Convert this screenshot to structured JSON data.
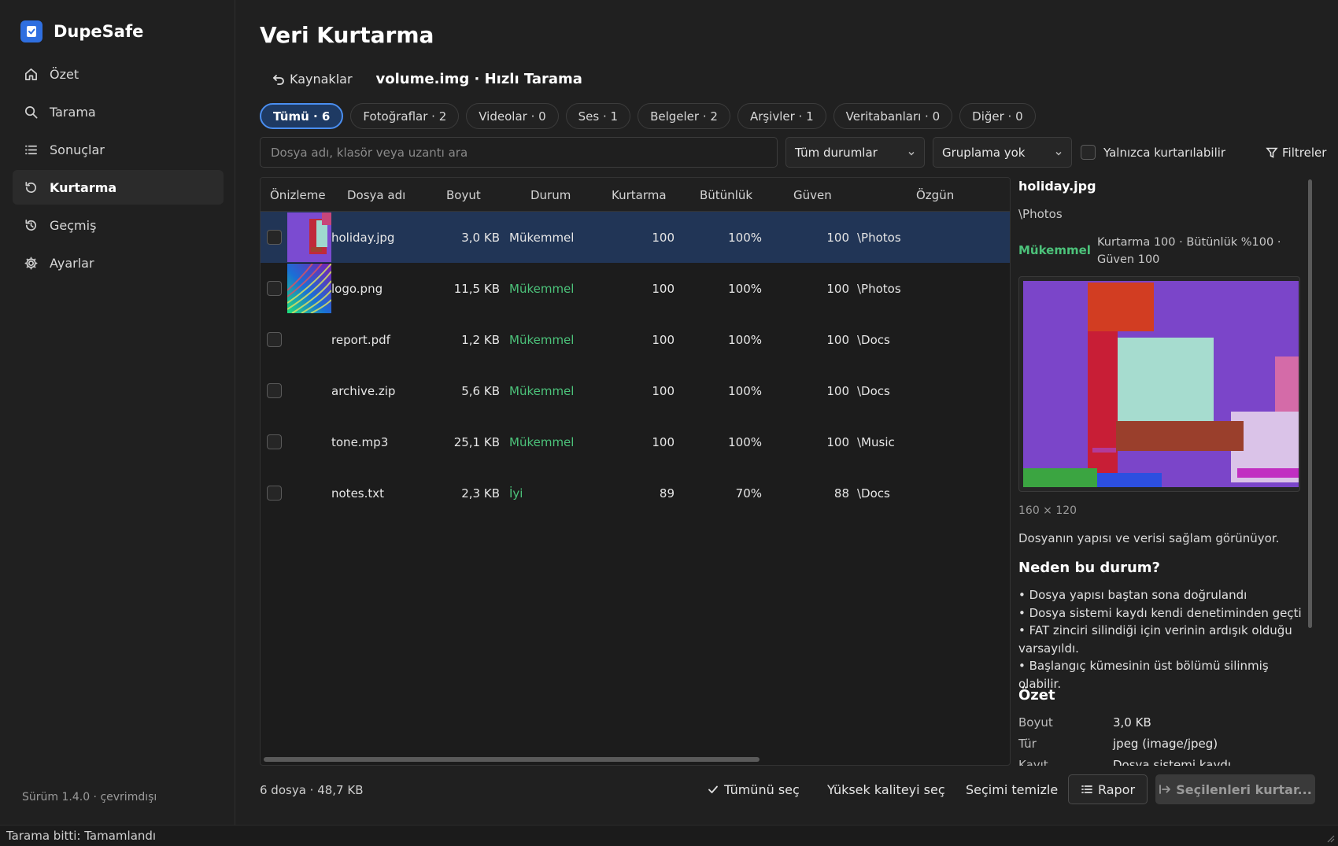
{
  "app": {
    "name": "DupeSafe",
    "version": "Sürüm 1.4.0 · çevrimdışı",
    "status": "Tarama bitti: Tamamlandı"
  },
  "sidebar": {
    "items": [
      {
        "label": "Özet",
        "icon": "home-icon"
      },
      {
        "label": "Tarama",
        "icon": "search-icon"
      },
      {
        "label": "Sonuçlar",
        "icon": "list-icon"
      },
      {
        "label": "Kurtarma",
        "icon": "restore-icon",
        "active": true
      },
      {
        "label": "Geçmiş",
        "icon": "history-icon"
      },
      {
        "label": "Ayarlar",
        "icon": "gear-icon"
      }
    ]
  },
  "main": {
    "title": "Veri Kurtarma",
    "back_label": "Kaynaklar",
    "scan_title": "volume.img · Hızlı Tarama",
    "chips": [
      "Tümü · 6",
      "Fotoğraflar · 2",
      "Videolar · 0",
      "Ses · 1",
      "Belgeler · 2",
      "Arşivler · 1",
      "Veritabanları · 0",
      "Diğer · 0"
    ],
    "search_placeholder": "Dosya adı, klasör veya uzantı ara",
    "status_filter": "Tüm durumlar",
    "grouping": "Gruplama yok",
    "only_recoverable": "Yalnızca kurtarılabilir",
    "filters_label": "Filtreler"
  },
  "table": {
    "headers": [
      "Önizleme",
      "Dosya adı",
      "Boyut",
      "Durum",
      "Kurtarma",
      "Bütünlük",
      "Güven",
      "Özgün"
    ],
    "rows": [
      {
        "name": "holiday.jpg",
        "size": "3,0 KB",
        "status": "Mükemmel",
        "recovery": "100",
        "integrity": "100%",
        "confidence": "100",
        "path": "\\Photos",
        "selected": true
      },
      {
        "name": "logo.png",
        "size": "11,5 KB",
        "status": "Mükemmel",
        "recovery": "100",
        "integrity": "100%",
        "confidence": "100",
        "path": "\\Photos"
      },
      {
        "name": "report.pdf",
        "size": "1,2 KB",
        "status": "Mükemmel",
        "recovery": "100",
        "integrity": "100%",
        "confidence": "100",
        "path": "\\Docs"
      },
      {
        "name": "archive.zip",
        "size": "5,6 KB",
        "status": "Mükemmel",
        "recovery": "100",
        "integrity": "100%",
        "confidence": "100",
        "path": "\\Docs"
      },
      {
        "name": "tone.mp3",
        "size": "25,1 KB",
        "status": "Mükemmel",
        "recovery": "100",
        "integrity": "100%",
        "confidence": "100",
        "path": "\\Music"
      },
      {
        "name": "notes.txt",
        "size": "2,3 KB",
        "status": "İyi",
        "recovery": "89",
        "integrity": "70%",
        "confidence": "88",
        "path": "\\Docs"
      }
    ]
  },
  "detail": {
    "name": "holiday.jpg",
    "path": "\\Photos",
    "status": "Mükemmel",
    "metrics": "Kurtarma 100 · Bütünlük %100 · Güven 100",
    "dimensions": "160 × 120",
    "description": "Dosyanın yapısı ve verisi sağlam görünüyor.",
    "why_title": "Neden bu durum?",
    "reasons": [
      "• Dosya yapısı baştan sona doğrulandı",
      "• Dosya sistemi kaydı kendi denetiminden geçti",
      "• FAT zinciri silindiği için verinin ardışık olduğu varsayıldı.",
      "• Başlangıç kümesinin üst bölümü silinmiş olabilir."
    ],
    "summary_title": "Özet",
    "summary": [
      {
        "key": "Boyut",
        "value": "3,0 KB"
      },
      {
        "key": "Tür",
        "value": "jpeg (image/jpeg)"
      },
      {
        "key": "Kayıt",
        "value": "Dosya sistemi kaydı"
      }
    ]
  },
  "footer": {
    "count": "6 dosya · 48,7 KB",
    "select_all": "Tümünü seç",
    "select_hq": "Yüksek kaliteyi seç",
    "clear": "Seçimi temizle",
    "report": "Rapor",
    "recover": "Seçilenleri kurtar..."
  },
  "colors": {
    "accent": "#4a8ef0",
    "success": "#4cc27a",
    "selected_row": "#213556"
  }
}
